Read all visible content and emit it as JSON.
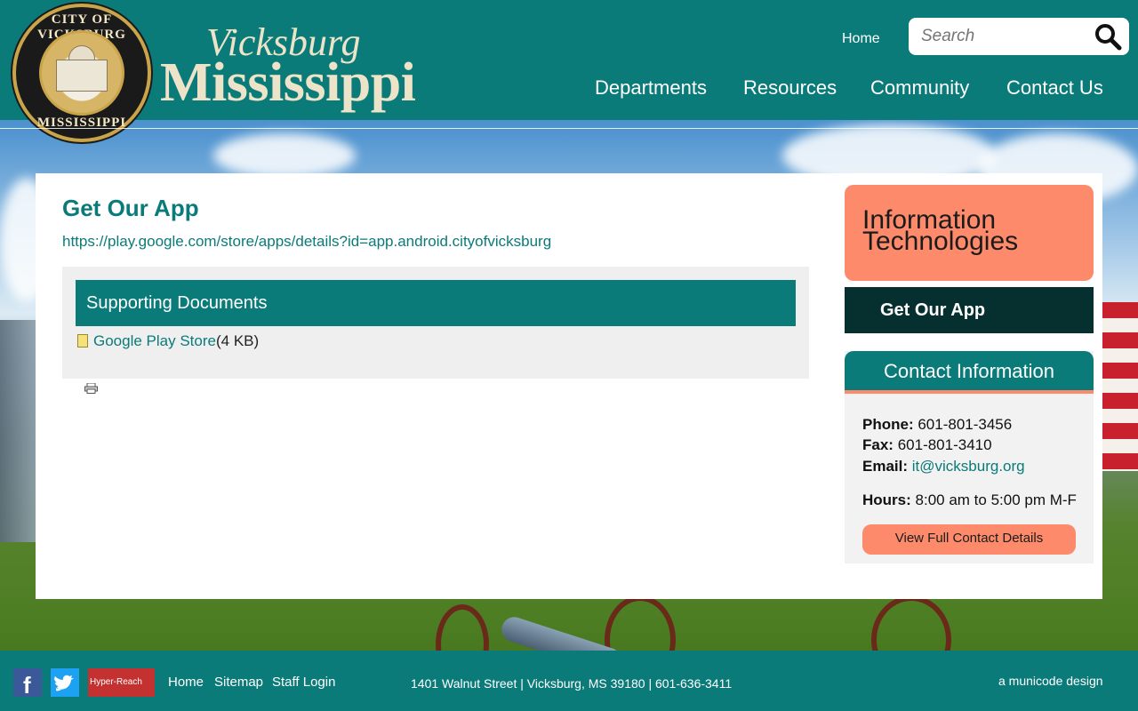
{
  "header": {
    "seal_top_text": "CITY OF VICKSBURG",
    "seal_bottom_text": "MISSISSIPPI",
    "logo_script": "Vicksburg",
    "logo_main": "Mississippi",
    "home_link": "Home",
    "search_placeholder": "Search",
    "nav": [
      "Departments",
      "Resources",
      "Community",
      "Contact Us"
    ]
  },
  "main": {
    "page_title": "Get Our App",
    "app_url": "https://play.google.com/store/apps/details?id=app.android.cityofvicksburg",
    "documents": {
      "heading": "Supporting Documents",
      "items": [
        {
          "name": "Google Play Store",
          "size": "(4 KB)"
        }
      ]
    }
  },
  "sidebar": {
    "department_line1": "Information",
    "department_line2": "Technologies",
    "active_item": "Get Our App",
    "contact": {
      "heading": "Contact Information",
      "phone_label": "Phone:",
      "phone": "601-801-3456",
      "fax_label": "Fax:",
      "fax": "601-801-3410",
      "email_label": "Email:",
      "email": "it@vicksburg.org",
      "hours_label": "Hours:",
      "hours": "8:00 am to 5:00 pm M-F",
      "button": "View Full Contact Details"
    }
  },
  "footer": {
    "hyper_reach": "Hyper-Reach",
    "links": [
      "Home",
      "Sitemap",
      "Staff Login"
    ],
    "address": "1401 Walnut Street | Vicksburg, MS 39180 | 601-636-3411",
    "credit": "a municode design"
  },
  "colors": {
    "teal": "#0a7b79",
    "coral": "#fd8a6a",
    "dark_teal": "#06302f"
  }
}
